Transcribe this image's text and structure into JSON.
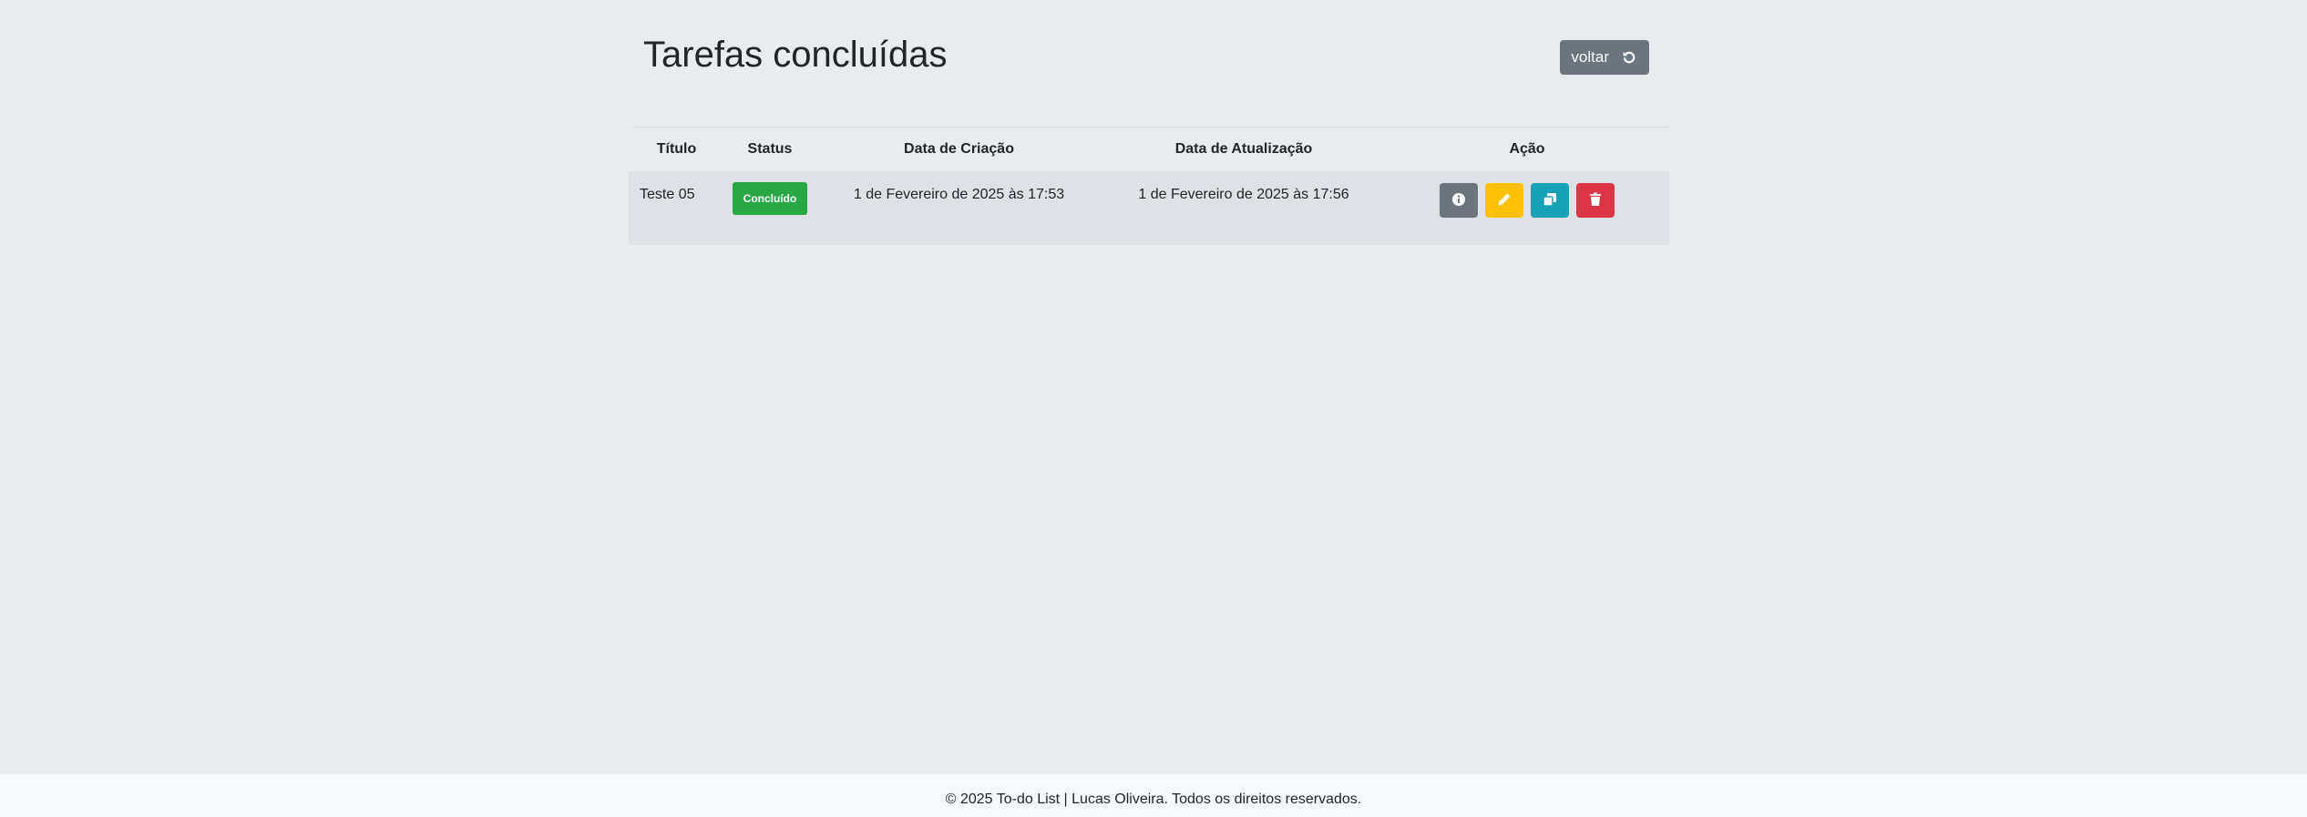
{
  "page": {
    "title": "Tarefas concluídas",
    "back_button_label": "voltar"
  },
  "table": {
    "headers": [
      "Título",
      "Status",
      "Data de Criação",
      "Data de Atualização",
      "Ação"
    ],
    "rows": [
      {
        "title": "Teste 05",
        "status": "Concluído",
        "created_at": "1 de Fevereiro de 2025 às 17:53",
        "updated_at": "1 de Fevereiro de 2025 às 17:56",
        "actions": [
          {
            "icon": "info-icon",
            "color": "#6c757d"
          },
          {
            "icon": "pencil-icon",
            "color": "#ffc107"
          },
          {
            "icon": "copy-icon",
            "color": "#17a2b8"
          },
          {
            "icon": "trash-icon",
            "color": "#dc3545"
          }
        ]
      }
    ]
  },
  "footer": {
    "text": "© 2025 To-do List | Lucas Oliveira. Todos os direitos reservados."
  },
  "colors": {
    "background": "#e9ecef",
    "secondary": "#6c757d",
    "success": "#28a745",
    "warning": "#ffc107",
    "info": "#17a2b8",
    "danger": "#dc3545",
    "footer_background": "#f8f9fa"
  }
}
